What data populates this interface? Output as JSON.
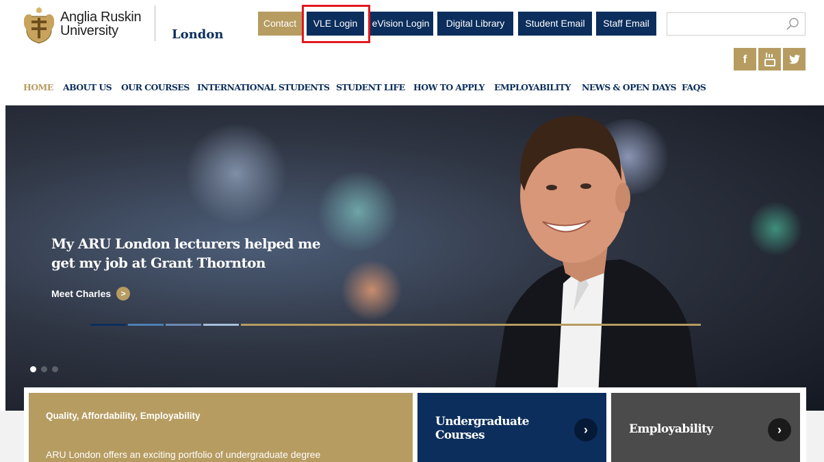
{
  "header": {
    "logo_line1": "Anglia Ruskin",
    "logo_line2": "University",
    "campus": "London"
  },
  "top_links": [
    {
      "label": "Contact",
      "style": "gold"
    },
    {
      "label": "VLE Login",
      "style": "navy"
    },
    {
      "label": "eVision Login",
      "style": "navy"
    },
    {
      "label": "Digital Library",
      "style": "navy"
    },
    {
      "label": "Student Email",
      "style": "navy"
    },
    {
      "label": "Staff Email",
      "style": "navy"
    }
  ],
  "search": {
    "value": "",
    "placeholder": ""
  },
  "social": [
    {
      "icon": "facebook-icon",
      "glyph": "f"
    },
    {
      "icon": "youtube-icon",
      "glyph": "You Tube"
    },
    {
      "icon": "twitter-icon",
      "glyph": "bird"
    }
  ],
  "nav": [
    {
      "label": "HOME",
      "active": true
    },
    {
      "label": "ABOUT US"
    },
    {
      "label": "OUR COURSES"
    },
    {
      "label": "INTERNATIONAL STUDENTS"
    },
    {
      "label": "STUDENT LIFE"
    },
    {
      "label": "HOW TO APPLY"
    },
    {
      "label": "EMPLOYABILITY"
    },
    {
      "label": "NEWS & OPEN DAYS"
    },
    {
      "label": "FAQS"
    }
  ],
  "hero": {
    "title_line1": "My ARU London lecturers helped me",
    "title_line2": "get my job at Grant Thornton",
    "cta_label": "Meet Charles",
    "cta_glyph": ">",
    "slide_count": 3,
    "active_slide": 1
  },
  "panels": {
    "info_title": "Quality, Affordability, Employability",
    "info_body": "ARU London offers an exciting portfolio of undergraduate degree",
    "undergrad_line1": "Undergraduate",
    "undergrad_line2": "Courses",
    "employability": "Employability",
    "arrow_glyph": "›"
  },
  "colors": {
    "gold": "#b69c61",
    "navy": "#0b2e5d",
    "grey": "#4b4b4b",
    "highlight": "#e3151d"
  }
}
